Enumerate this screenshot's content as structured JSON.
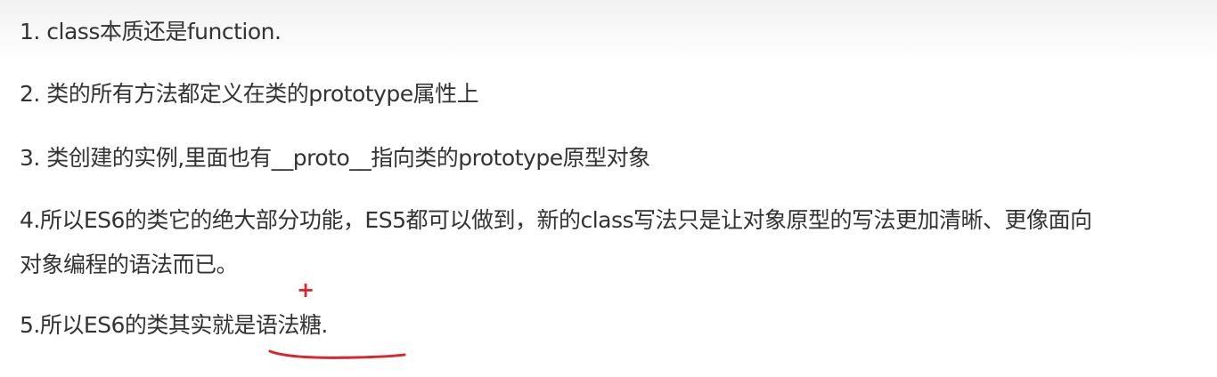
{
  "document": {
    "items": [
      "1. class本质还是function.",
      "2. 类的所有方法都定义在类的prototype属性上",
      "3. 类创建的实例,里面也有__proto__指向类的prototype原型对象",
      "4.所以ES6的类它的绝大部分功能，ES5都可以做到，新的class写法只是让对象原型的写法更加清晰、更像面向",
      "对象编程的语法而已。",
      "5.所以ES6的类其实就是语法糖."
    ]
  },
  "annotations": {
    "plus": "+",
    "color": "#d9262b"
  }
}
